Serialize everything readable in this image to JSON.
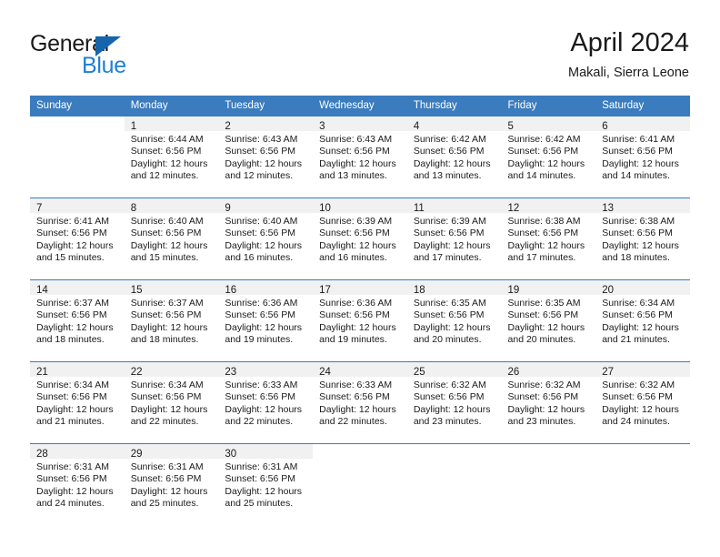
{
  "brand": {
    "name_top": "General",
    "name_bottom": "Blue",
    "triangle_icon": "triangle-icon",
    "accent_blue": "#1f7fd4",
    "logo_dark": "#1a1a1a"
  },
  "header": {
    "title": "April 2024",
    "subtitle": "Makali, Sierra Leone"
  },
  "theme": {
    "header_bg": "#3a7cbe",
    "daynum_band_bg": "#f1f1f1",
    "row_divider": "#3a7cbe",
    "text": "#1a1a1a"
  },
  "weekday_headers": [
    "Sunday",
    "Monday",
    "Tuesday",
    "Wednesday",
    "Thursday",
    "Friday",
    "Saturday"
  ],
  "labels": {
    "sunrise_prefix": "Sunrise:",
    "sunset_prefix": "Sunset:",
    "daylight_prefix": "Daylight:"
  },
  "weeks": [
    [
      {
        "day": "",
        "lines": [],
        "empty": true
      },
      {
        "day": "1",
        "lines": [
          "Sunrise: 6:44 AM",
          "Sunset: 6:56 PM",
          "Daylight: 12 hours",
          "and 12 minutes."
        ],
        "empty": false
      },
      {
        "day": "2",
        "lines": [
          "Sunrise: 6:43 AM",
          "Sunset: 6:56 PM",
          "Daylight: 12 hours",
          "and 12 minutes."
        ],
        "empty": false
      },
      {
        "day": "3",
        "lines": [
          "Sunrise: 6:43 AM",
          "Sunset: 6:56 PM",
          "Daylight: 12 hours",
          "and 13 minutes."
        ],
        "empty": false
      },
      {
        "day": "4",
        "lines": [
          "Sunrise: 6:42 AM",
          "Sunset: 6:56 PM",
          "Daylight: 12 hours",
          "and 13 minutes."
        ],
        "empty": false
      },
      {
        "day": "5",
        "lines": [
          "Sunrise: 6:42 AM",
          "Sunset: 6:56 PM",
          "Daylight: 12 hours",
          "and 14 minutes."
        ],
        "empty": false
      },
      {
        "day": "6",
        "lines": [
          "Sunrise: 6:41 AM",
          "Sunset: 6:56 PM",
          "Daylight: 12 hours",
          "and 14 minutes."
        ],
        "empty": false
      }
    ],
    [
      {
        "day": "7",
        "lines": [
          "Sunrise: 6:41 AM",
          "Sunset: 6:56 PM",
          "Daylight: 12 hours",
          "and 15 minutes."
        ],
        "empty": false
      },
      {
        "day": "8",
        "lines": [
          "Sunrise: 6:40 AM",
          "Sunset: 6:56 PM",
          "Daylight: 12 hours",
          "and 15 minutes."
        ],
        "empty": false
      },
      {
        "day": "9",
        "lines": [
          "Sunrise: 6:40 AM",
          "Sunset: 6:56 PM",
          "Daylight: 12 hours",
          "and 16 minutes."
        ],
        "empty": false
      },
      {
        "day": "10",
        "lines": [
          "Sunrise: 6:39 AM",
          "Sunset: 6:56 PM",
          "Daylight: 12 hours",
          "and 16 minutes."
        ],
        "empty": false
      },
      {
        "day": "11",
        "lines": [
          "Sunrise: 6:39 AM",
          "Sunset: 6:56 PM",
          "Daylight: 12 hours",
          "and 17 minutes."
        ],
        "empty": false
      },
      {
        "day": "12",
        "lines": [
          "Sunrise: 6:38 AM",
          "Sunset: 6:56 PM",
          "Daylight: 12 hours",
          "and 17 minutes."
        ],
        "empty": false
      },
      {
        "day": "13",
        "lines": [
          "Sunrise: 6:38 AM",
          "Sunset: 6:56 PM",
          "Daylight: 12 hours",
          "and 18 minutes."
        ],
        "empty": false
      }
    ],
    [
      {
        "day": "14",
        "lines": [
          "Sunrise: 6:37 AM",
          "Sunset: 6:56 PM",
          "Daylight: 12 hours",
          "and 18 minutes."
        ],
        "empty": false
      },
      {
        "day": "15",
        "lines": [
          "Sunrise: 6:37 AM",
          "Sunset: 6:56 PM",
          "Daylight: 12 hours",
          "and 18 minutes."
        ],
        "empty": false
      },
      {
        "day": "16",
        "lines": [
          "Sunrise: 6:36 AM",
          "Sunset: 6:56 PM",
          "Daylight: 12 hours",
          "and 19 minutes."
        ],
        "empty": false
      },
      {
        "day": "17",
        "lines": [
          "Sunrise: 6:36 AM",
          "Sunset: 6:56 PM",
          "Daylight: 12 hours",
          "and 19 minutes."
        ],
        "empty": false
      },
      {
        "day": "18",
        "lines": [
          "Sunrise: 6:35 AM",
          "Sunset: 6:56 PM",
          "Daylight: 12 hours",
          "and 20 minutes."
        ],
        "empty": false
      },
      {
        "day": "19",
        "lines": [
          "Sunrise: 6:35 AM",
          "Sunset: 6:56 PM",
          "Daylight: 12 hours",
          "and 20 minutes."
        ],
        "empty": false
      },
      {
        "day": "20",
        "lines": [
          "Sunrise: 6:34 AM",
          "Sunset: 6:56 PM",
          "Daylight: 12 hours",
          "and 21 minutes."
        ],
        "empty": false
      }
    ],
    [
      {
        "day": "21",
        "lines": [
          "Sunrise: 6:34 AM",
          "Sunset: 6:56 PM",
          "Daylight: 12 hours",
          "and 21 minutes."
        ],
        "empty": false
      },
      {
        "day": "22",
        "lines": [
          "Sunrise: 6:34 AM",
          "Sunset: 6:56 PM",
          "Daylight: 12 hours",
          "and 22 minutes."
        ],
        "empty": false
      },
      {
        "day": "23",
        "lines": [
          "Sunrise: 6:33 AM",
          "Sunset: 6:56 PM",
          "Daylight: 12 hours",
          "and 22 minutes."
        ],
        "empty": false
      },
      {
        "day": "24",
        "lines": [
          "Sunrise: 6:33 AM",
          "Sunset: 6:56 PM",
          "Daylight: 12 hours",
          "and 22 minutes."
        ],
        "empty": false
      },
      {
        "day": "25",
        "lines": [
          "Sunrise: 6:32 AM",
          "Sunset: 6:56 PM",
          "Daylight: 12 hours",
          "and 23 minutes."
        ],
        "empty": false
      },
      {
        "day": "26",
        "lines": [
          "Sunrise: 6:32 AM",
          "Sunset: 6:56 PM",
          "Daylight: 12 hours",
          "and 23 minutes."
        ],
        "empty": false
      },
      {
        "day": "27",
        "lines": [
          "Sunrise: 6:32 AM",
          "Sunset: 6:56 PM",
          "Daylight: 12 hours",
          "and 24 minutes."
        ],
        "empty": false
      }
    ],
    [
      {
        "day": "28",
        "lines": [
          "Sunrise: 6:31 AM",
          "Sunset: 6:56 PM",
          "Daylight: 12 hours",
          "and 24 minutes."
        ],
        "empty": false
      },
      {
        "day": "29",
        "lines": [
          "Sunrise: 6:31 AM",
          "Sunset: 6:56 PM",
          "Daylight: 12 hours",
          "and 25 minutes."
        ],
        "empty": false
      },
      {
        "day": "30",
        "lines": [
          "Sunrise: 6:31 AM",
          "Sunset: 6:56 PM",
          "Daylight: 12 hours",
          "and 25 minutes."
        ],
        "empty": false
      },
      {
        "day": "",
        "lines": [],
        "empty": true
      },
      {
        "day": "",
        "lines": [],
        "empty": true
      },
      {
        "day": "",
        "lines": [],
        "empty": true
      },
      {
        "day": "",
        "lines": [],
        "empty": true
      }
    ]
  ]
}
